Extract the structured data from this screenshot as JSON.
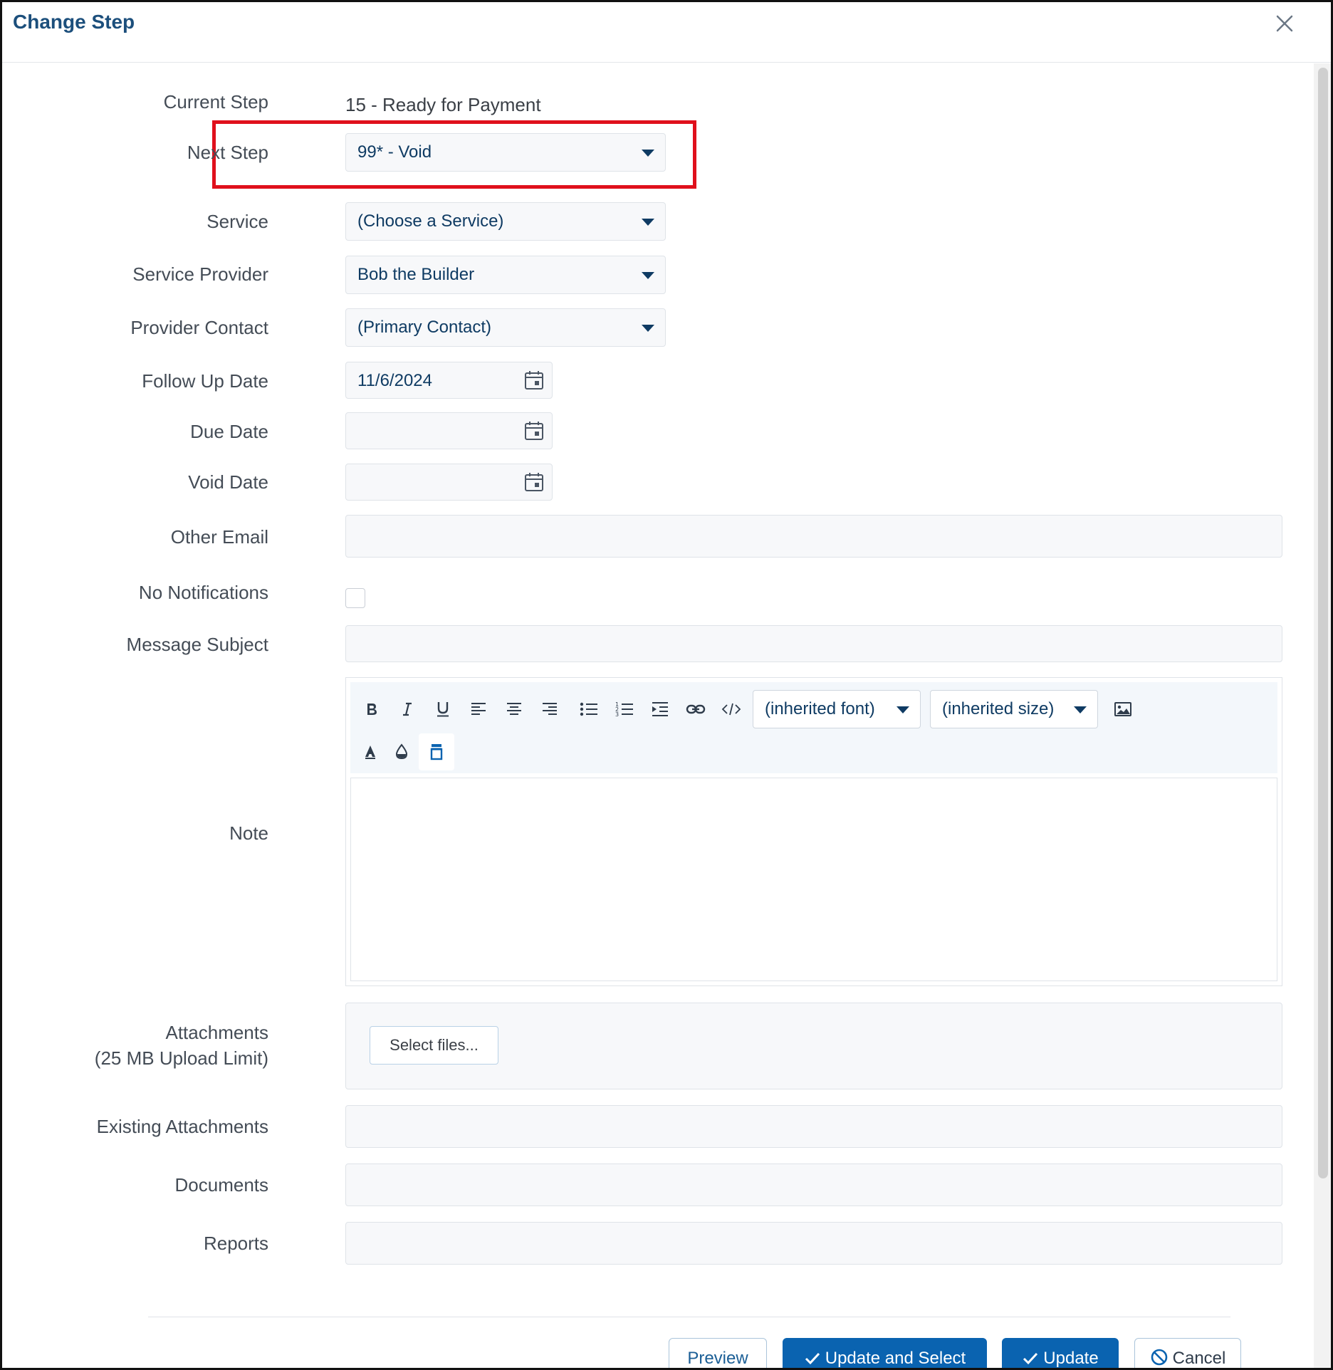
{
  "dialog": {
    "title": "Change Step",
    "close_icon": "close-icon"
  },
  "form": {
    "current_step": {
      "label": "Current Step",
      "value": "15 - Ready for Payment"
    },
    "next_step": {
      "label": "Next Step",
      "value": "99* - Void"
    },
    "service": {
      "label": "Service",
      "value": "(Choose a Service)"
    },
    "service_provider": {
      "label": "Service Provider",
      "value": "Bob the Builder"
    },
    "provider_contact": {
      "label": "Provider Contact",
      "value": "(Primary Contact)"
    },
    "follow_up_date": {
      "label": "Follow Up Date",
      "value": "11/6/2024"
    },
    "due_date": {
      "label": "Due Date",
      "value": ""
    },
    "void_date": {
      "label": "Void Date",
      "value": ""
    },
    "other_email": {
      "label": "Other Email",
      "value": ""
    },
    "no_notifications": {
      "label": "No Notifications",
      "checked": false
    },
    "message_subject": {
      "label": "Message Subject",
      "value": ""
    },
    "note": {
      "label": "Note",
      "toolbar": {
        "font": "(inherited font)",
        "size": "(inherited size)",
        "icons": [
          "bold-icon",
          "italic-icon",
          "underline-icon",
          "align-left-icon",
          "align-center-icon",
          "align-right-icon",
          "bulleted-list-icon",
          "numbered-list-icon",
          "indent-icon",
          "link-icon",
          "code-icon",
          "image-icon",
          "font-color-icon",
          "background-color-icon",
          "clean-formatting-icon"
        ]
      }
    },
    "attachments": {
      "label_line1": "Attachments",
      "label_line2": "(25 MB Upload Limit)",
      "button": "Select files..."
    },
    "existing_attachments": {
      "label": "Existing Attachments"
    },
    "documents": {
      "label": "Documents"
    },
    "reports": {
      "label": "Reports"
    }
  },
  "footer": {
    "preview": "Preview",
    "update_and_select": "Update and Select",
    "update": "Update",
    "cancel": "Cancel"
  },
  "colors": {
    "accent": "#0a63b0",
    "title": "#1c4f7c",
    "highlight": "#e0101c"
  }
}
